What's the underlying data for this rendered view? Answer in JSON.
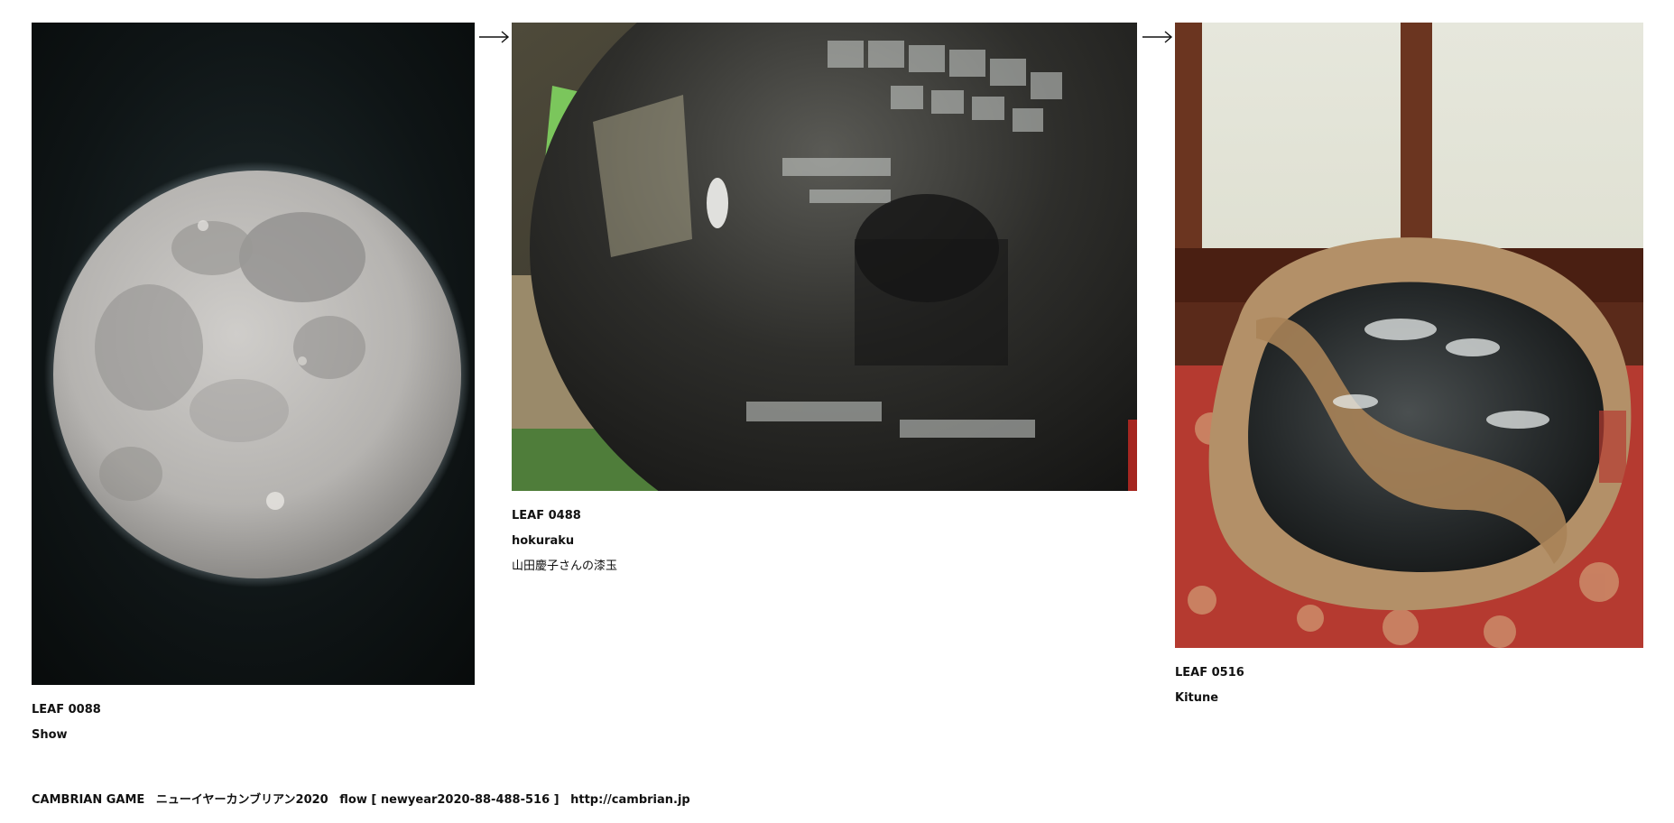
{
  "leaves": [
    {
      "title": "LEAF 0088",
      "author": "Show",
      "note": ""
    },
    {
      "title": "LEAF 0488",
      "author": "hokuraku",
      "note": "山田慶子さんの漆玉"
    },
    {
      "title": "LEAF 0516",
      "author": "Kitune",
      "note": ""
    }
  ],
  "icons": {
    "arrow": "right-arrow-icon"
  },
  "footer": {
    "game": "CAMBRIAN GAME",
    "event": "ニューイヤーカンブリアン2020",
    "flow": "flow [ newyear2020-88-488-516 ]",
    "link": "http://cambrian.jp"
  }
}
